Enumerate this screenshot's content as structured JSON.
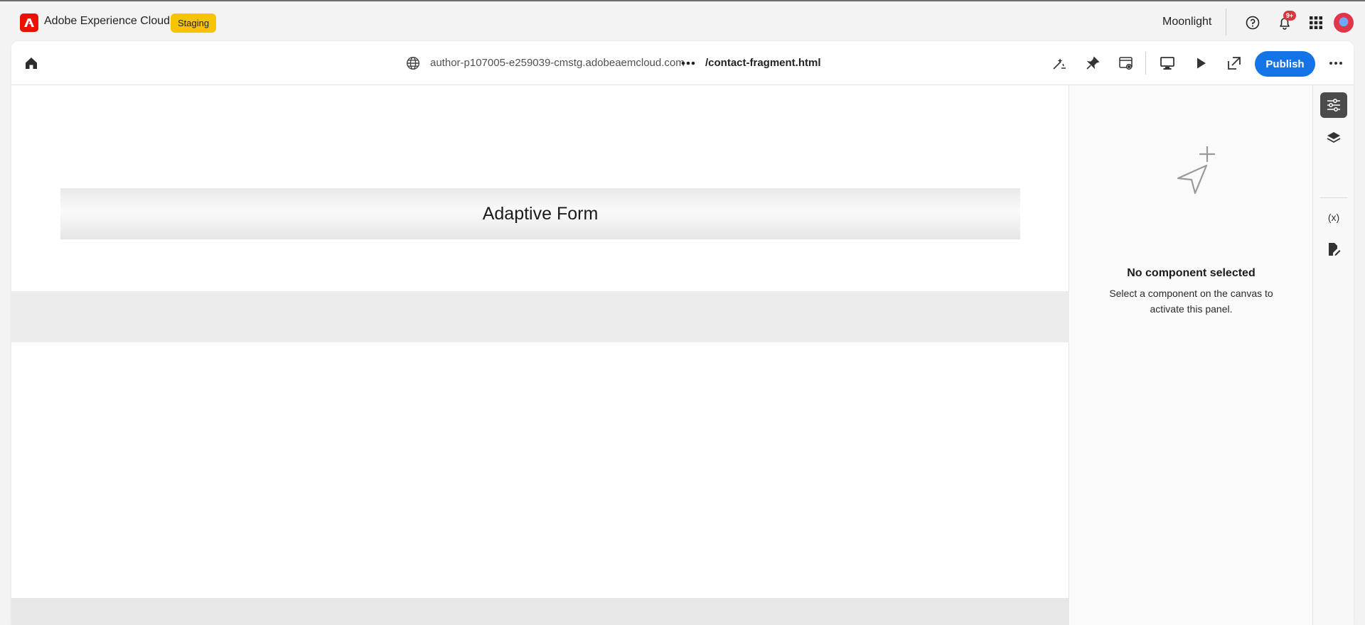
{
  "shell": {
    "app_title": "Adobe Experience Cloud",
    "environment_badge": "Staging",
    "org_name": "Moonlight",
    "notification_count": "9+",
    "icons": [
      "adobe-logo-icon",
      "help-icon",
      "bell-icon",
      "app-grid-icon",
      "avatar"
    ]
  },
  "toolbar": {
    "url_host": "author-p107005-e259039-cmstg.adobeaemcloud.com",
    "url_path": "/contact-fragment.html",
    "publish_label": "Publish",
    "icons": [
      "home-icon",
      "globe-icon",
      "more-icon",
      "wand-icon",
      "pin-icon",
      "page-settings-icon",
      "desktop-icon",
      "play-icon",
      "open-external-icon",
      "more-icon"
    ]
  },
  "canvas": {
    "form_title": "Adaptive Form"
  },
  "properties_panel": {
    "empty_title": "No component selected",
    "empty_description": "Select a component on the canvas to activate this panel."
  },
  "rail": {
    "items": [
      "properties-icon",
      "layers-icon",
      "variables-icon",
      "edit-document-icon"
    ],
    "variables_label": "(x)"
  },
  "colors": {
    "brand_red": "#eb1000",
    "staging_yellow": "#f6c500",
    "publish_blue": "#1473e6",
    "notification_red": "#d7373f"
  }
}
